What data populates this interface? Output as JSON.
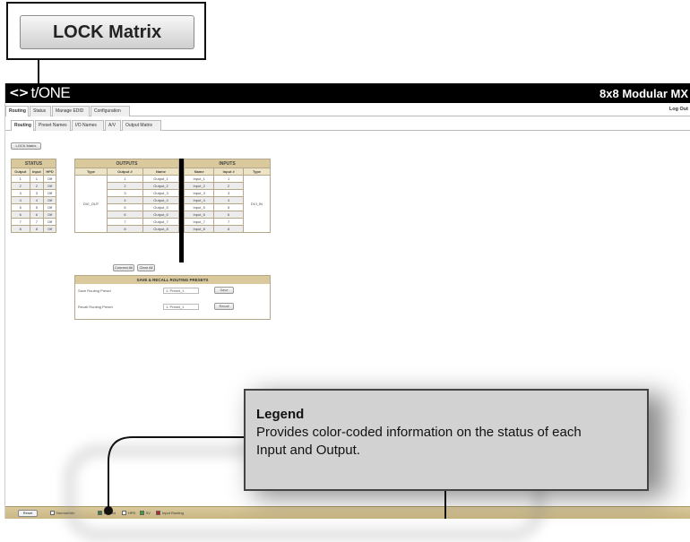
{
  "callouts": {
    "lock_button_label": "LOCK Matrix",
    "legend_title": "Legend",
    "legend_desc": "Provides color-coded information on the status of each Input and Output."
  },
  "app": {
    "brand_mark": "<>",
    "brand_name": "t/ONE",
    "product_name": "8x8 Modular MX",
    "logout_label": "Log Out",
    "main_tabs": [
      "Routing",
      "Status",
      "Manage EDID",
      "Configuration"
    ],
    "sub_tabs": [
      "Routing",
      "Preset Names",
      "I/O Names",
      "A/V",
      "Output Matrix"
    ],
    "lock_matrix_small": "LOCK Matrix"
  },
  "status_table": {
    "title": "STATUS",
    "headers": [
      "Output",
      "Input",
      "HPD"
    ],
    "rows": [
      [
        "1",
        "1",
        "Off"
      ],
      [
        "2",
        "2",
        "Off"
      ],
      [
        "3",
        "3",
        "Off"
      ],
      [
        "4",
        "4",
        "Off"
      ],
      [
        "5",
        "5",
        "Off"
      ],
      [
        "6",
        "6",
        "Off"
      ],
      [
        "7",
        "7",
        "Off"
      ],
      [
        "8",
        "8",
        "Off"
      ]
    ]
  },
  "outputs_table": {
    "title": "OUTPUTS",
    "headers": [
      "Type",
      "Output #",
      "Name"
    ],
    "type": "DVI_OUT",
    "rows": [
      [
        "1",
        "Output_1"
      ],
      [
        "2",
        "Output_2"
      ],
      [
        "3",
        "Output_3"
      ],
      [
        "4",
        "Output_4"
      ],
      [
        "5",
        "Output_5"
      ],
      [
        "6",
        "Output_6"
      ],
      [
        "7",
        "Output_7"
      ],
      [
        "8",
        "Output_8"
      ]
    ]
  },
  "inputs_table": {
    "title": "INPUTS",
    "headers": [
      "Name",
      "Input #",
      "Type"
    ],
    "type": "DVI_IN",
    "rows": [
      [
        "Input_1",
        "1"
      ],
      [
        "Input_2",
        "2"
      ],
      [
        "Input_3",
        "3"
      ],
      [
        "Input_4",
        "4"
      ],
      [
        "Input_5",
        "5"
      ],
      [
        "Input_6",
        "6"
      ],
      [
        "Input_7",
        "7"
      ],
      [
        "Input_8",
        "8"
      ]
    ]
  },
  "routing_buttons": {
    "connect_all": "Connect All",
    "clear_all": "Clear All"
  },
  "presets": {
    "title": "SAVE & RECALL ROUTING PRESETS",
    "save_label": "Save Routing Preset",
    "save_value": "1: Preset_1",
    "save_button": "Save",
    "recall_label": "Recall Routing Preset",
    "recall_value": "1: Preset_1",
    "recall_button": "Recall"
  },
  "legend_bar": {
    "reset_label": "Reset",
    "items": [
      {
        "label": "Normal/Idle",
        "color": "#f0f0f0"
      },
      {
        "label": "Locked",
        "color": "#3d7a3d"
      },
      {
        "label": "HPD",
        "color": "#ffffff"
      },
      {
        "label": "5V",
        "color": "#39a03c"
      },
      {
        "label": "Input Routing",
        "color": "#c0211e"
      }
    ]
  }
}
